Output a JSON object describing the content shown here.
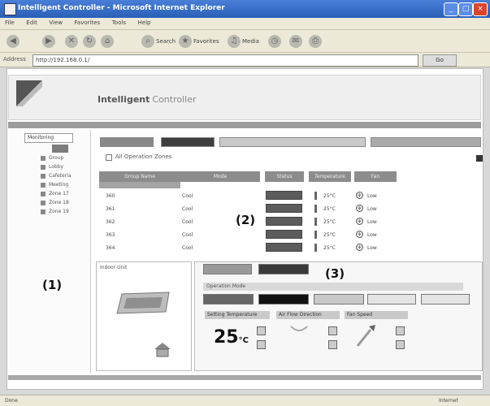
{
  "window": {
    "title": "Intelligent Controller - Microsoft Internet Explorer",
    "buttons": [
      "_",
      "□",
      "×"
    ]
  },
  "menu": [
    "File",
    "Edit",
    "View",
    "Favorites",
    "Tools",
    "Help"
  ],
  "toolbar": {
    "search": "Search",
    "favorites": "Favorites",
    "media": "Media"
  },
  "address": {
    "label": "Address",
    "value": "http://192.168.0.1/",
    "go": "Go"
  },
  "brand": {
    "name": "Intelligent",
    "sub": "Controller"
  },
  "tree": {
    "root": "Monitoring",
    "items": [
      "Group",
      "Lobby",
      "Cafeteria",
      "Meeting",
      "Zone 17",
      "Zone 18",
      "Zone 19"
    ]
  },
  "tabs": [
    "",
    "",
    "",
    ""
  ],
  "path": "All Operation Zones",
  "table": {
    "headers": [
      "Group Name",
      "Mode",
      "Status",
      "Temperature",
      "Fan"
    ],
    "rows": [
      {
        "name": "360",
        "mode": "Cool",
        "status": "",
        "temp": "25°C",
        "fan": "Low"
      },
      {
        "name": "361",
        "mode": "Cool",
        "status": "",
        "temp": "25°C",
        "fan": "Low"
      },
      {
        "name": "362",
        "mode": "Cool",
        "status": "",
        "temp": "25°C",
        "fan": "Low"
      },
      {
        "name": "363",
        "mode": "Cool",
        "status": "",
        "temp": "25°C",
        "fan": "Low"
      },
      {
        "name": "364",
        "mode": "Cool",
        "status": "",
        "temp": "25°C",
        "fan": "Low"
      }
    ]
  },
  "annotations": {
    "a1": "(1)",
    "a2": "(2)",
    "a3": "(3)"
  },
  "detail": {
    "label": "Indoor Unit",
    "on_label": "",
    "off_label": "",
    "subhead": "Operation Mode",
    "modes": [
      "",
      "",
      "",
      "",
      ""
    ],
    "sections": [
      "Setting Temperature",
      "Air Flow Direction",
      "Fan Speed"
    ],
    "set_temp": "25",
    "set_unit": "°C"
  },
  "status": {
    "left": "Done",
    "right": "Internet"
  }
}
